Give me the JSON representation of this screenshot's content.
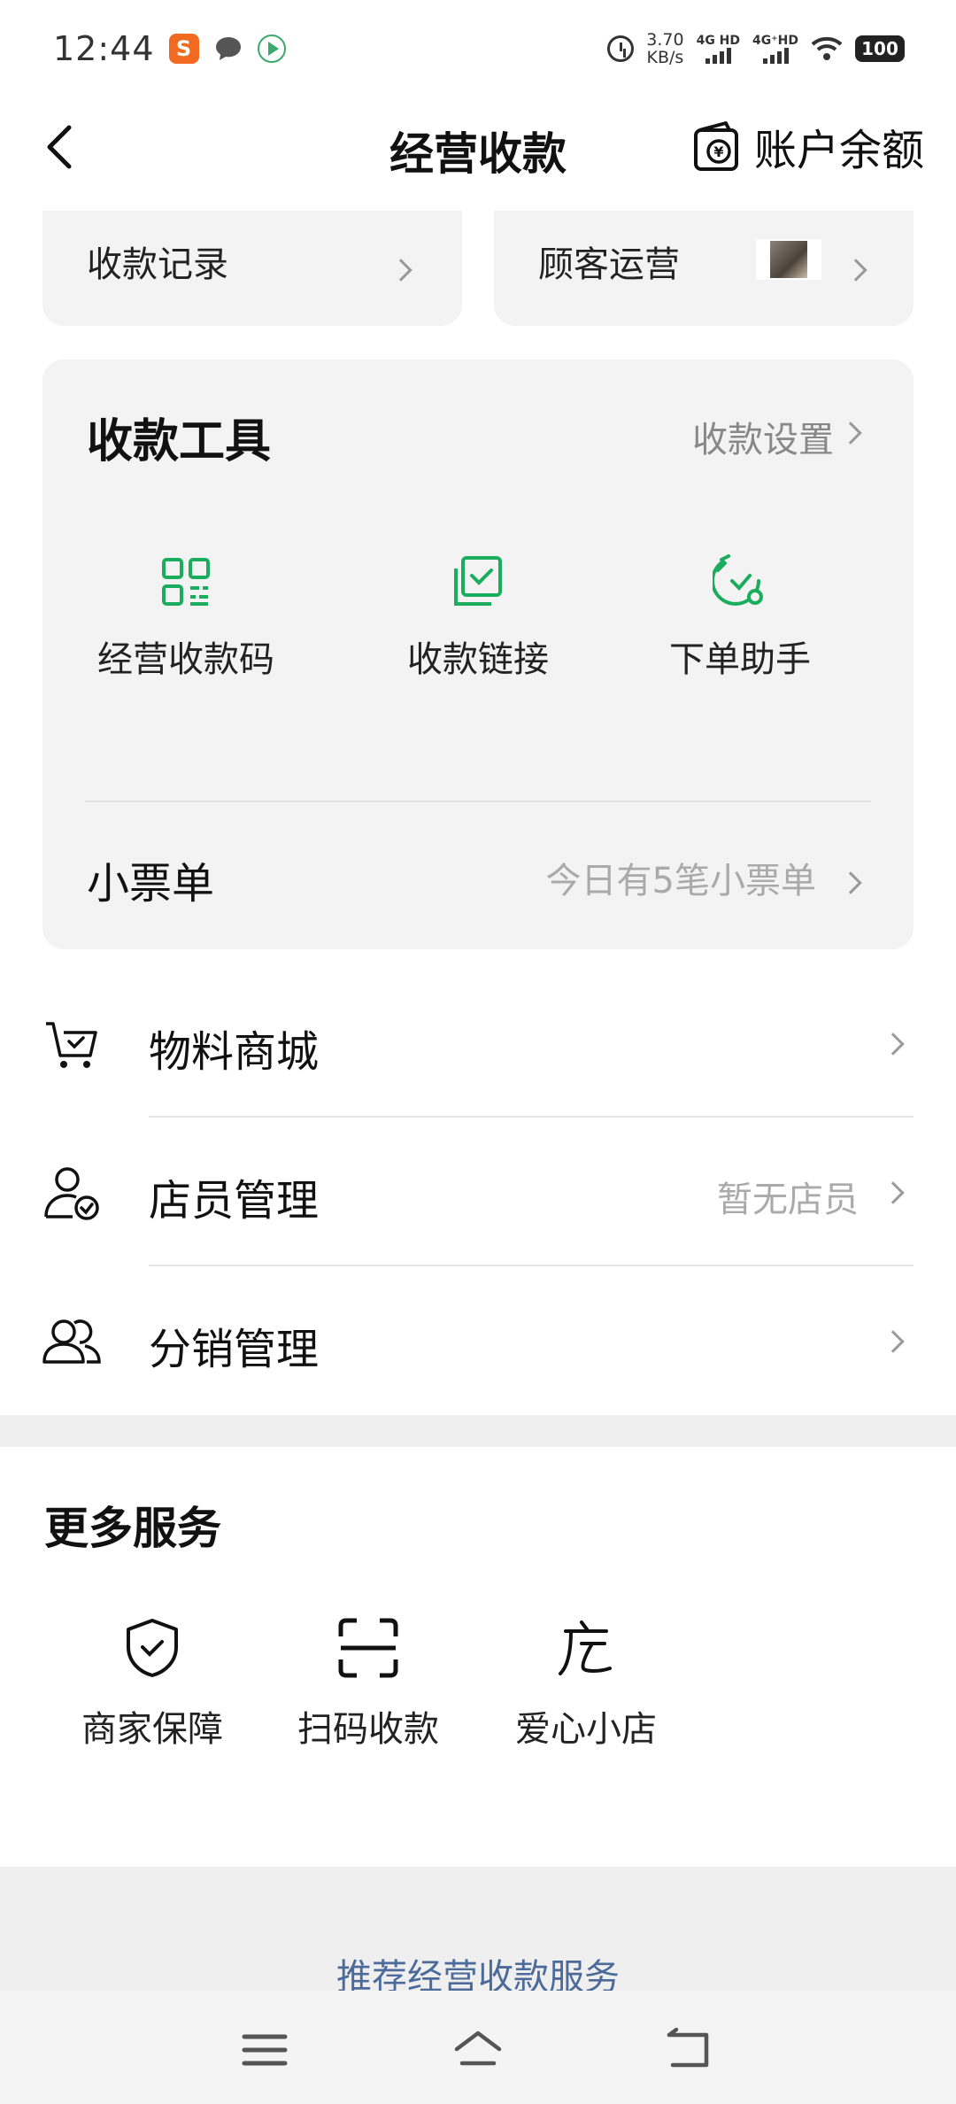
{
  "status_bar": {
    "time": "12:44",
    "app_badge_s": "S",
    "net_speed_value": "3.70",
    "net_speed_unit": "KB/s",
    "sim1": "4G HD",
    "sim2": "4G⁺HD",
    "battery": "100"
  },
  "nav": {
    "title": "经营收款",
    "account_balance": "账户余额"
  },
  "top_cards": {
    "records": "收款记录",
    "customer_ops": "顾客运营"
  },
  "tools": {
    "title": "收款工具",
    "settings": "收款设置",
    "items": [
      {
        "label": "经营收款码"
      },
      {
        "label": "收款链接"
      },
      {
        "label": "下单助手"
      }
    ],
    "ticket_title": "小票单",
    "ticket_status": "今日有5笔小票单",
    "accent_color": "#1aad5d"
  },
  "list": {
    "mall": "物料商城",
    "staff": "店员管理",
    "staff_status": "暂无店员",
    "distribution": "分销管理"
  },
  "more_services": {
    "title": "更多服务",
    "items": [
      {
        "label": "商家保障"
      },
      {
        "label": "扫码收款"
      },
      {
        "label": "爱心小店"
      }
    ]
  },
  "recommend": "推荐经营收款服务"
}
